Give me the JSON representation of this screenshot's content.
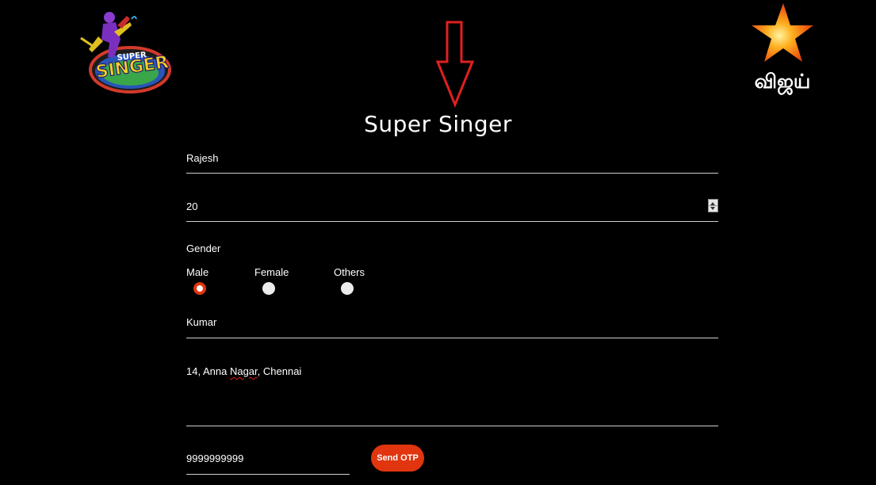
{
  "header": {
    "title": "Super Singer",
    "left_logo": {
      "name": "super-singer-logo",
      "text": "SUPER SINGER"
    },
    "right_logo": {
      "name": "star-vijay-logo",
      "text": "விஜய்"
    }
  },
  "annotation": {
    "type": "down-arrow",
    "color": "#e02020"
  },
  "form": {
    "name": {
      "value": "Rajesh"
    },
    "age": {
      "value": "20"
    },
    "gender": {
      "label": "Gender",
      "options": [
        "Male",
        "Female",
        "Others"
      ],
      "selected": "Male"
    },
    "father_name": {
      "value": "Kumar"
    },
    "address": {
      "value_parts": [
        "14, Anna ",
        "Nagar",
        ", Chennai"
      ]
    },
    "phone": {
      "value": "9999999999"
    },
    "send_otp_label": "Send OTP"
  },
  "colors": {
    "background": "#000000",
    "accent": "#e0350f",
    "text": "#ffffff",
    "underline": "#cfcfcf"
  }
}
